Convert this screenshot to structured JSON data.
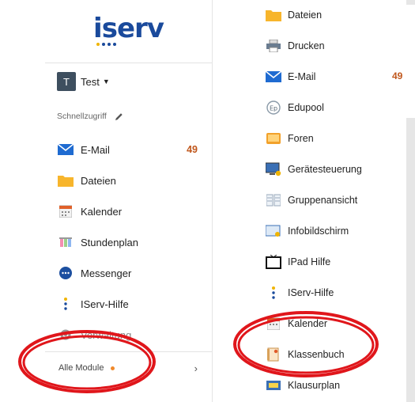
{
  "logo": {
    "text": "iserv"
  },
  "user": {
    "initial": "T",
    "name": "Test"
  },
  "quick_access": {
    "heading": "Schnellzugriff"
  },
  "left_nav": [
    {
      "label": "E-Mail",
      "icon": "mail-icon",
      "badge": "49"
    },
    {
      "label": "Dateien",
      "icon": "folder-icon"
    },
    {
      "label": "Kalender",
      "icon": "calendar-icon"
    },
    {
      "label": "Stundenplan",
      "icon": "timetable-icon"
    },
    {
      "label": "Messenger",
      "icon": "messenger-icon"
    },
    {
      "label": "IServ-Hilfe",
      "icon": "help-icon"
    },
    {
      "label": "Verwaltung",
      "icon": "gear-icon"
    }
  ],
  "all_modules": {
    "label": "Alle Module",
    "chevron": "›"
  },
  "module_list": [
    {
      "label": "Dateien",
      "icon": "folder-icon"
    },
    {
      "label": "Drucken",
      "icon": "printer-icon"
    },
    {
      "label": "E-Mail",
      "icon": "mail-icon",
      "badge": "49"
    },
    {
      "label": "Edupool",
      "icon": "edupool-icon"
    },
    {
      "label": "Foren",
      "icon": "forum-icon"
    },
    {
      "label": "Gerätesteuerung",
      "icon": "device-control-icon"
    },
    {
      "label": "Gruppenansicht",
      "icon": "group-view-icon"
    },
    {
      "label": "Infobildschirm",
      "icon": "info-screen-icon"
    },
    {
      "label": "IPad Hilfe",
      "icon": "ipad-icon"
    },
    {
      "label": "IServ-Hilfe",
      "icon": "help-icon"
    },
    {
      "label": "Kalender",
      "icon": "calendar-icon"
    },
    {
      "label": "Klassenbuch",
      "icon": "classbook-icon"
    },
    {
      "label": "Klausurplan",
      "icon": "exam-plan-icon"
    }
  ],
  "colors": {
    "brand_blue": "#1a4a9c",
    "badge": "#c0571c",
    "highlight_ring": "#e0161b",
    "orange_dot": "#f0892b"
  }
}
